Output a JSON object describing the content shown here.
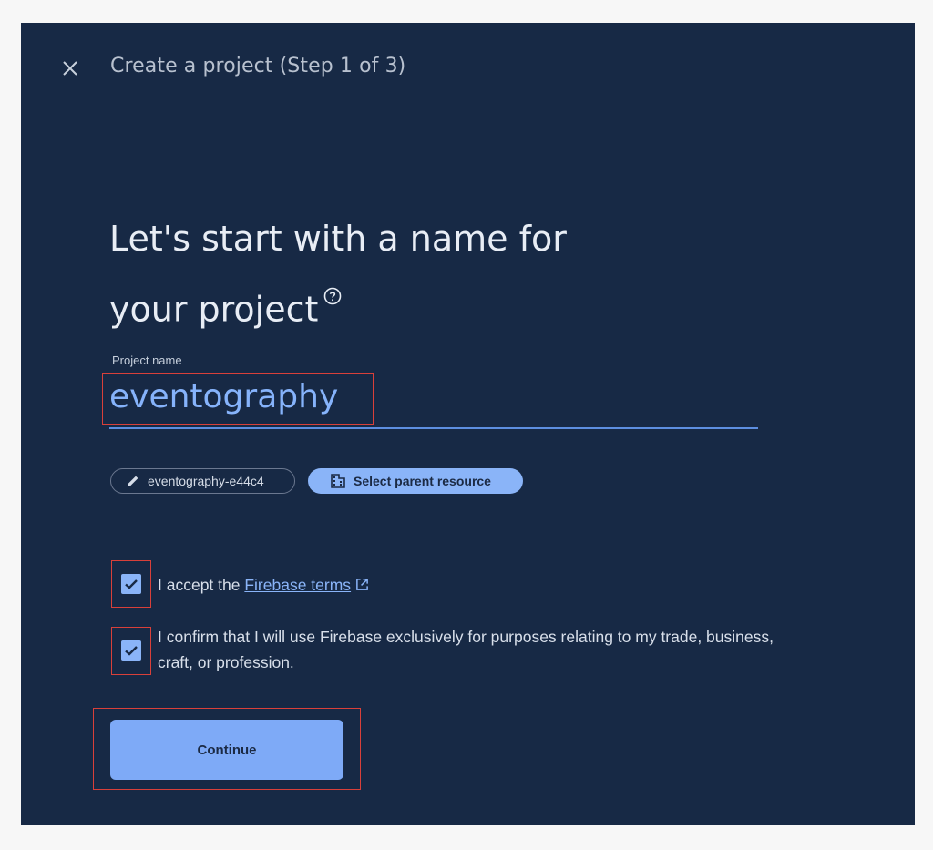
{
  "header": {
    "title": "Create a project (Step 1 of 3)"
  },
  "main": {
    "headline_line1": "Let's start with a name for",
    "headline_line2": "your project"
  },
  "project_name": {
    "label": "Project name",
    "value": "eventography"
  },
  "chips": {
    "project_id": "eventography-e44c4",
    "parent_resource": "Select parent resource"
  },
  "consent": {
    "terms_prefix": "I accept the",
    "terms_link": "Firebase terms",
    "terms_checked": true,
    "confirm_line1": "I confirm that I will use Firebase exclusively for purposes relating to my trade, business,",
    "confirm_line2": "craft, or profession.",
    "confirm_checked": true
  },
  "actions": {
    "continue_label": "Continue"
  },
  "colors": {
    "panel_bg": "#172945",
    "accent": "#8ab4f8",
    "highlight": "#d9403a"
  }
}
